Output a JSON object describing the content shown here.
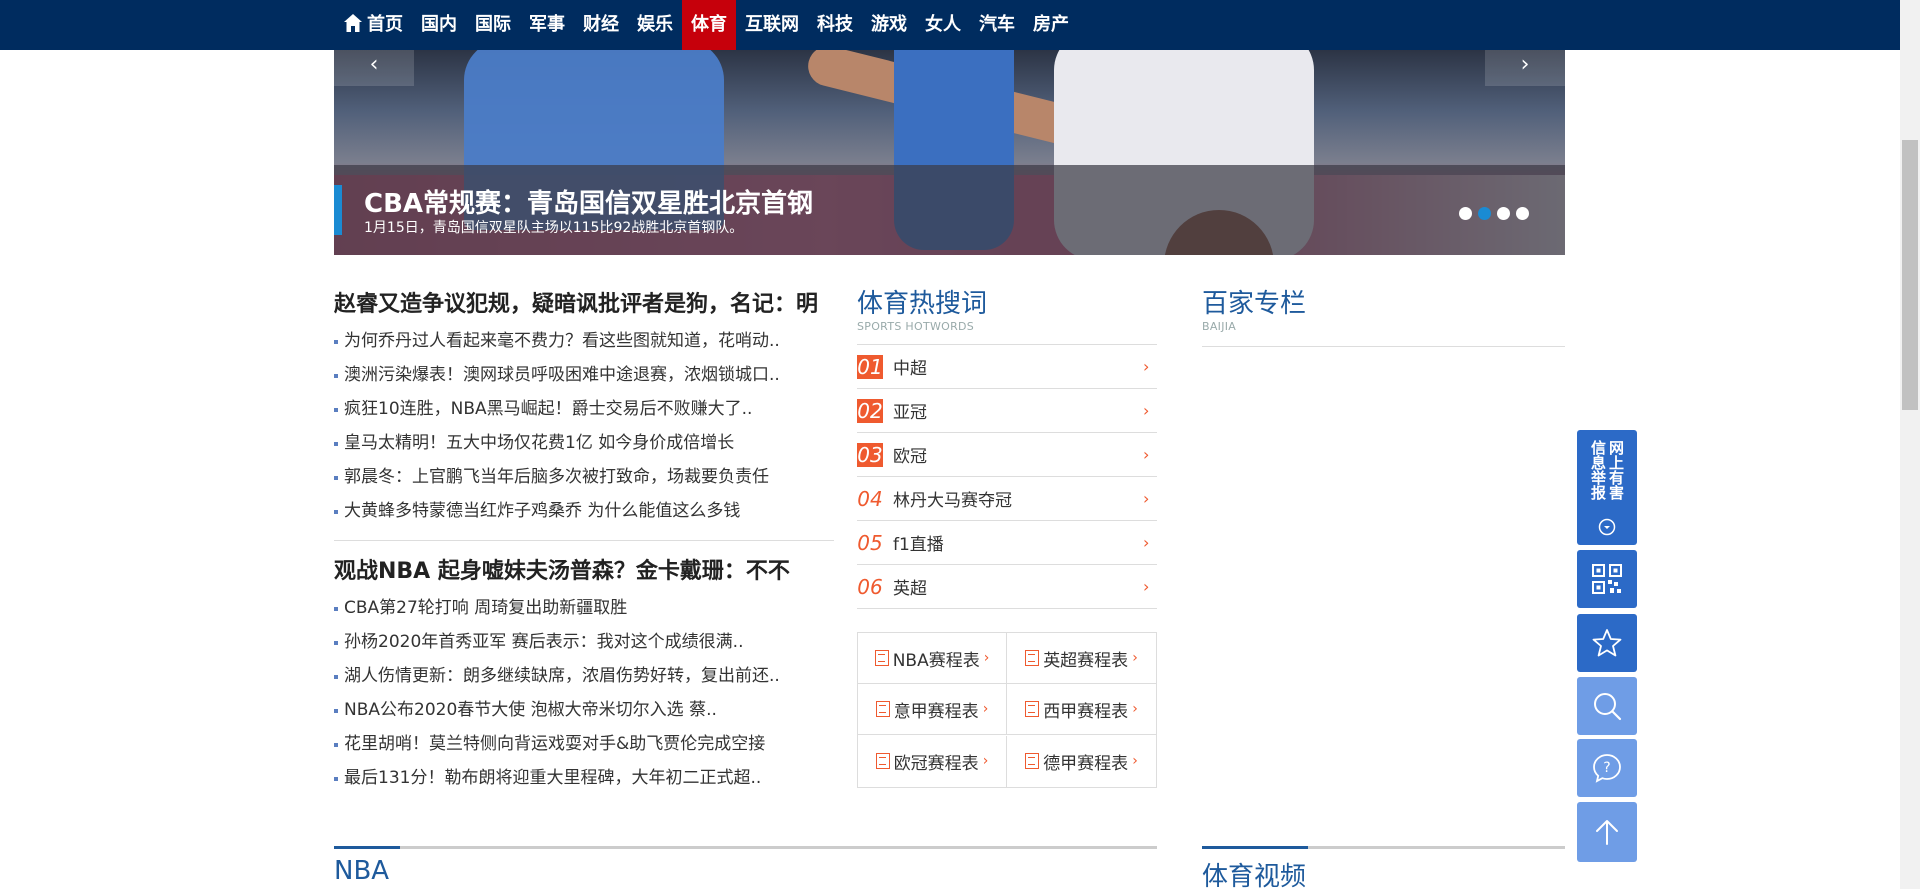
{
  "nav": {
    "items": [
      "首页",
      "国内",
      "国际",
      "军事",
      "财经",
      "娱乐",
      "体育",
      "互联网",
      "科技",
      "游戏",
      "女人",
      "汽车",
      "房产"
    ],
    "active": "体育"
  },
  "banner": {
    "title": "CBA常规赛：青岛国信双星胜北京首钢",
    "subtitle": "1月15日，青岛国信双星队主场以115比92战胜北京首钢队。",
    "prev": "‹",
    "next": "›",
    "slides": 4,
    "active_slide": 2
  },
  "news": [
    {
      "headline": "赵睿又造争议犯规，疑暗讽批评者是狗，名记：明",
      "items": [
        "为何乔丹过人看起来毫不费力？看这些图就知道，花哨动..",
        "澳洲污染爆表！澳网球员呼吸困难中途退赛，浓烟锁城口..",
        "疯狂10连胜，NBA黑马崛起！爵士交易后不败赚大了..",
        "皇马太精明！五大中场仅花费1亿 如今身价成倍增长",
        "郭晨冬：上官鹏飞当年后脑多次被打致命，场裁要负责任",
        "大黄蜂多特蒙德当红炸子鸡桑乔 为什么能值这么多钱"
      ]
    },
    {
      "headline": "观战NBA 起身嘘妹夫汤普森？金卡戴珊：不不",
      "items": [
        "CBA第27轮打响 周琦复出助新疆取胜",
        "孙杨2020年首秀亚军 赛后表示：我对这个成绩很满..",
        "湖人伤情更新：朗多继续缺席，浓眉伤势好转，复出前还..",
        "NBA公布2020春节大使 泡椒大帝米切尔入选 蔡..",
        "花里胡哨！莫兰特侧向背运戏耍对手&助飞贾伦完成空接",
        "最后131分！勒布朗将迎重大里程碑，大年初二正式超.."
      ]
    }
  ],
  "hotwords": {
    "title": "体育热搜词",
    "subtitle": "SPORTS HOTWORDS",
    "items": [
      {
        "num": "01",
        "word": "中超"
      },
      {
        "num": "02",
        "word": "亚冠"
      },
      {
        "num": "03",
        "word": "欧冠"
      },
      {
        "num": "04",
        "word": "林丹大马赛夺冠"
      },
      {
        "num": "05",
        "word": "f1直播"
      },
      {
        "num": "06",
        "word": "英超"
      }
    ]
  },
  "schedules": [
    "NBA赛程表",
    "英超赛程表",
    "意甲赛程表",
    "西甲赛程表",
    "欧冠赛程表",
    "德甲赛程表"
  ],
  "baijia": {
    "title": "百家专栏",
    "subtitle": "BAIJIA"
  },
  "bottom": {
    "nba": "NBA",
    "video": "体育视频"
  },
  "toolbar": {
    "report": "网上有害信息举报",
    "icons": [
      "qrcode-icon",
      "star-icon",
      "search-icon",
      "help-icon",
      "arrow-up-icon"
    ]
  },
  "colors": {
    "nav_bg": "#002c5f",
    "nav_active": "#c6000b",
    "accent_blue": "#1e5a9c",
    "accent_orange": "#ef5a2f",
    "tool_blue": "#2c6ac7"
  }
}
